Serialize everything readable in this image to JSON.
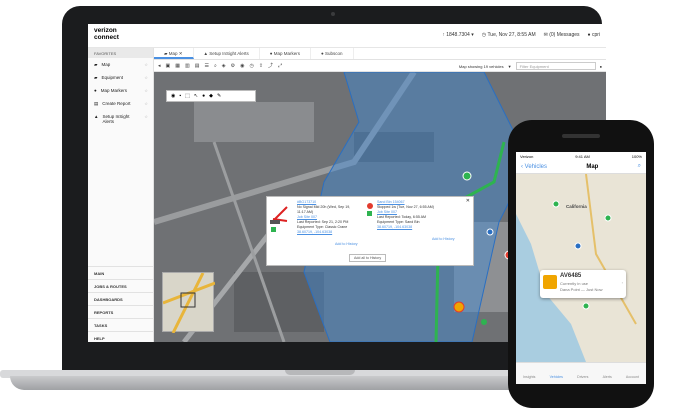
{
  "brand": {
    "line1": "verizon",
    "line2": "connect"
  },
  "header": {
    "vehicle_count": "1848.7304",
    "datetime": "Tue, Nov 27, 8:55 AM",
    "messages": "(0) Messages",
    "user": "cpri"
  },
  "sidebar": {
    "header": "FAVORITES",
    "items": [
      {
        "label": "Map"
      },
      {
        "label": "Equipment"
      },
      {
        "label": "Map Markers"
      },
      {
        "label": "Create Report"
      },
      {
        "label": "Setup InSight Alerts"
      }
    ],
    "bottom": [
      "MAIN",
      "JOBS & ROUTES",
      "DASHBOARDS",
      "REPORTS",
      "TASKS",
      "HELP"
    ]
  },
  "tabs": [
    {
      "label": "Map"
    },
    {
      "label": "Setup InSight Alerts"
    },
    {
      "label": "Map Markers"
    },
    {
      "label": "Subscon"
    }
  ],
  "toolbar": {
    "map_showing": "Map showing 19 vehicles",
    "filter_placeholder": "Filter Equipment"
  },
  "popup": {
    "left": {
      "title": "#BG173710",
      "line1": "No Signal Mid 20h (Wed, Sep 19,",
      "line2": "11:17 AM)",
      "job": "Job Site 007",
      "reported": "Last Reported: Sep 21, 2:20 PM",
      "equipment": "Equipment Type: Classic Crane",
      "coords": "38.60719, -104.63038"
    },
    "right": {
      "title": "Sand Bin 154067",
      "line1": "Stopped 1w (Tue, Nov 27, 6:55 AM)",
      "job": "Job Site 007",
      "reported": "Last Reported: Today, 6:55 AM",
      "equipment": "Equipment Type: Sand Bin",
      "coords": "38.60719, -104.63038"
    },
    "add_history_left": "Add to History",
    "add_history_right": "Add to History",
    "add_all": "Add all to History"
  },
  "phone": {
    "carrier": "Verizon",
    "time": "9:41 AM",
    "battery": "100%",
    "back": "Vehicles",
    "title": "Map",
    "card_id": "AV6485",
    "card_status": "Currently in use",
    "card_place": "Dana Point",
    "card_time": "Just Now",
    "map_label": "California",
    "tabs": [
      "Insights",
      "Vehicles",
      "Drivers",
      "Alerts",
      "Account"
    ]
  },
  "colors": {
    "accent": "#4a90e2",
    "route": "#2eb350",
    "alert_red": "#e23b2e"
  }
}
